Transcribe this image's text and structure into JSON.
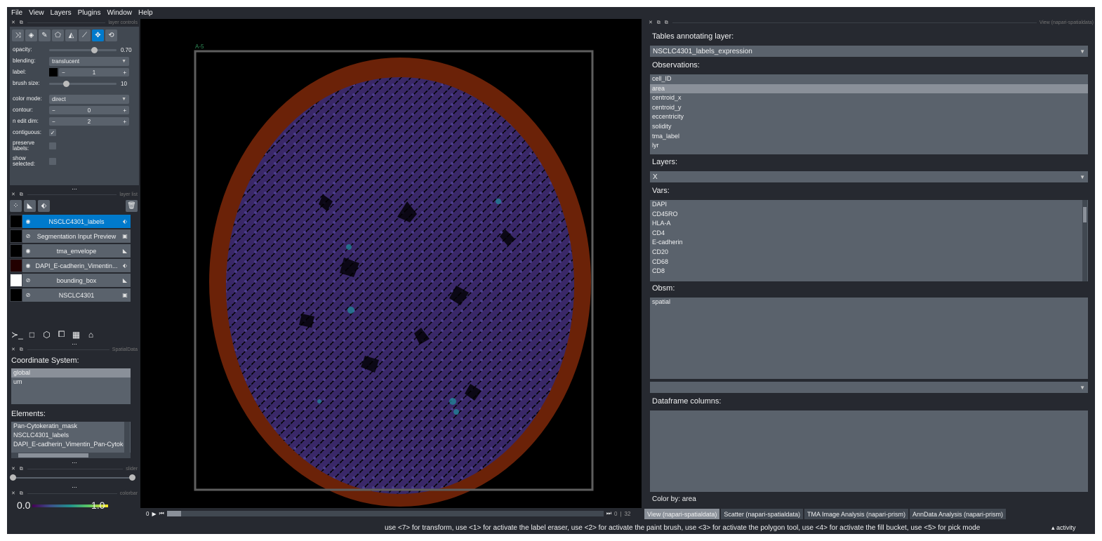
{
  "menubar": [
    "File",
    "View",
    "Layers",
    "Plugins",
    "Window",
    "Help"
  ],
  "layer_controls": {
    "title": "layer controls",
    "opacity_label": "opacity:",
    "opacity_value": "0.70",
    "opacity_fraction": 0.7,
    "blending_label": "blending:",
    "blending_value": "translucent",
    "label_label": "label:",
    "label_value": "1",
    "brush_label": "brush size:",
    "brush_value": "10",
    "color_mode_label": "color mode:",
    "color_mode_value": "direct",
    "contour_label": "contour:",
    "contour_value": "0",
    "n_edit_label": "n edit dim:",
    "n_edit_value": "2",
    "contiguous_label": "contiguous:",
    "preserve_label": "preserve labels:",
    "show_selected_label": "show selected:",
    "more": "..."
  },
  "layer_list": {
    "title": "layer list",
    "layers": [
      {
        "name": "NSCLC4301_labels",
        "selected": true
      },
      {
        "name": "Segmentation Input Preview",
        "selected": false
      },
      {
        "name": "tma_envelope",
        "selected": false
      },
      {
        "name": "DAPI_E-cadherin_Vimentin...",
        "selected": false
      },
      {
        "name": "bounding_box",
        "selected": false
      },
      {
        "name": "NSCLC4301",
        "selected": false
      }
    ]
  },
  "spatialdata": {
    "title": "SpatialData",
    "coord_label": "Coordinate System:",
    "coords": [
      "global",
      "um"
    ],
    "elements_label": "Elements:",
    "elements": [
      "Pan-Cytokeratin_mask",
      "NSCLC4301_labels",
      "DAPI_E-cadherin_Vimentin_Pan-Cytoke"
    ]
  },
  "slider_dock": {
    "title": "slider"
  },
  "colorbar": {
    "title": "colorbar",
    "min": "0.0",
    "max": "1.0"
  },
  "canvas": {
    "roi_label": "A-5"
  },
  "dims": {
    "position": "0",
    "total": "32",
    "play": "▶"
  },
  "right_panel": {
    "title": "View (napari-spatialdata)",
    "tables_label": "Tables annotating layer:",
    "table_value": "NSCLC4301_labels_expression",
    "observations_label": "Observations:",
    "observations": [
      "cell_ID",
      "area",
      "centroid_x",
      "centroid_y",
      "eccentricity",
      "solidity",
      "tma_label",
      "lyr"
    ],
    "layers_label": "Layers:",
    "layers_value": "X",
    "vars_label": "Vars:",
    "vars": [
      "DAPI",
      "CD45RO",
      "HLA-A",
      "CD4",
      "E-cadherin",
      "CD20",
      "CD68",
      "CD8"
    ],
    "obsm_label": "Obsm:",
    "obsm": [
      "spatial"
    ],
    "df_label": "Dataframe columns:",
    "color_by": "Color by: area"
  },
  "tabs": [
    {
      "label": "View (napari-spatialdata)",
      "active": true
    },
    {
      "label": "Scatter (napari-spatialdata)",
      "active": false
    },
    {
      "label": "TMA Image Analysis (napari-prism)",
      "active": false
    },
    {
      "label": "AnnData Analysis (napari-prism)",
      "active": false
    }
  ],
  "status": {
    "hint": "use <7> for transform, use <1> for activate the label eraser, use <2> for activate the paint brush, use <3> for activate the polygon tool, use <4> for activate the fill bucket, use <5> for pick mode",
    "activity": "activity"
  },
  "colors": {
    "accent": "#007acc",
    "panel": "#414851",
    "tissue_edge": "#6b2208",
    "tissue_cells": "#3d2a6e"
  }
}
